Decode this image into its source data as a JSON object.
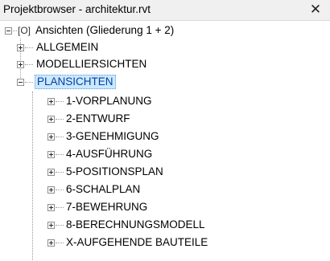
{
  "window": {
    "title": "Projektbrowser - architektur.rvt",
    "close_glyph": "✕"
  },
  "tree": {
    "root": {
      "icon": "views-icon",
      "icon_glyph": "[O]",
      "label": "Ansichten (Gliederung 1 + 2)"
    },
    "level1": [
      {
        "label": "ALLGEMEIN",
        "expanded": false
      },
      {
        "label": "MODELLIERSICHTEN",
        "expanded": false
      },
      {
        "label": "PLANSICHTEN",
        "expanded": true,
        "selected": true
      }
    ],
    "plansichten_children": [
      "1-VORPLANUNG",
      "2-ENTWURF",
      "3-GENEHMIGUNG",
      "4-AUSFÜHRUNG",
      "5-POSITIONSPLAN",
      "6-SCHALPLAN",
      "7-BEWEHRUNG",
      "8-BERECHNUNGSMODELL",
      "X-AUFGEHENDE BAUTEILE"
    ]
  }
}
